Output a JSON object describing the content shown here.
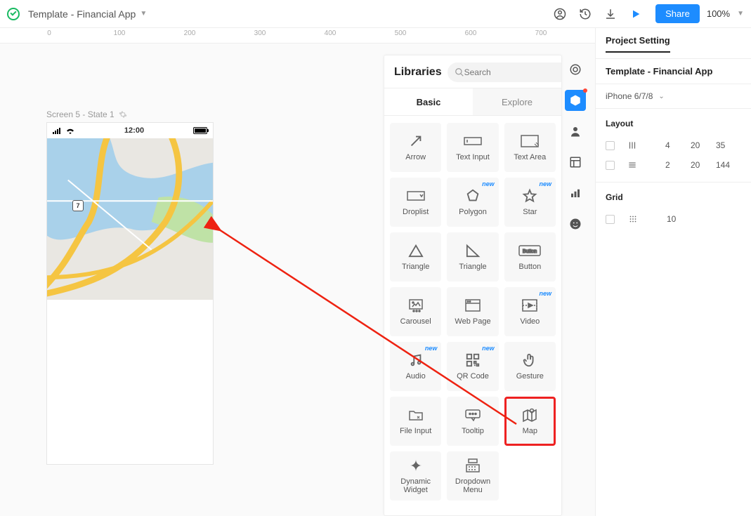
{
  "topbar": {
    "doc_title": "Template - Financial App",
    "share_label": "Share",
    "zoom": "100%"
  },
  "ruler_ticks": [
    "0",
    "100",
    "200",
    "300",
    "400",
    "500",
    "600",
    "700"
  ],
  "right": {
    "tab": "Project Setting",
    "project_name": "Template - Financial App",
    "device": "iPhone 6/7/8",
    "layout_label": "Layout",
    "layout_rows": [
      {
        "v1": "4",
        "v2": "20",
        "v3": "35"
      },
      {
        "v1": "2",
        "v2": "20",
        "v3": "144"
      }
    ],
    "grid_label": "Grid",
    "grid_value": "10"
  },
  "library": {
    "title": "Libraries",
    "search_placeholder": "Search",
    "tabs": {
      "basic": "Basic",
      "explore": "Explore"
    },
    "components": [
      {
        "label": "Arrow",
        "icon": "arrow"
      },
      {
        "label": "Text Input",
        "icon": "textinput"
      },
      {
        "label": "Text Area",
        "icon": "textarea"
      },
      {
        "label": "Droplist",
        "icon": "droplist"
      },
      {
        "label": "Polygon",
        "icon": "polygon",
        "new": true
      },
      {
        "label": "Star",
        "icon": "star",
        "new": true
      },
      {
        "label": "Triangle",
        "icon": "tri1"
      },
      {
        "label": "Triangle",
        "icon": "tri2"
      },
      {
        "label": "Button",
        "icon": "button"
      },
      {
        "label": "Carousel",
        "icon": "carousel"
      },
      {
        "label": "Web Page",
        "icon": "webpage"
      },
      {
        "label": "Video",
        "icon": "video",
        "new": true
      },
      {
        "label": "Audio",
        "icon": "audio",
        "new": true
      },
      {
        "label": "QR Code",
        "icon": "qr",
        "new": true
      },
      {
        "label": "Gesture",
        "icon": "gesture"
      },
      {
        "label": "File Input",
        "icon": "fileinput"
      },
      {
        "label": "Tooltip",
        "icon": "tooltip"
      },
      {
        "label": "Map",
        "icon": "map",
        "highlight": true
      },
      {
        "label": "Dynamic Widget",
        "icon": "dynamic"
      },
      {
        "label": "Dropdown Menu",
        "icon": "ddmenu"
      }
    ]
  },
  "canvas": {
    "screen_label": "Screen 5 - State 1",
    "status_time": "12:00",
    "map_marker": "7"
  }
}
